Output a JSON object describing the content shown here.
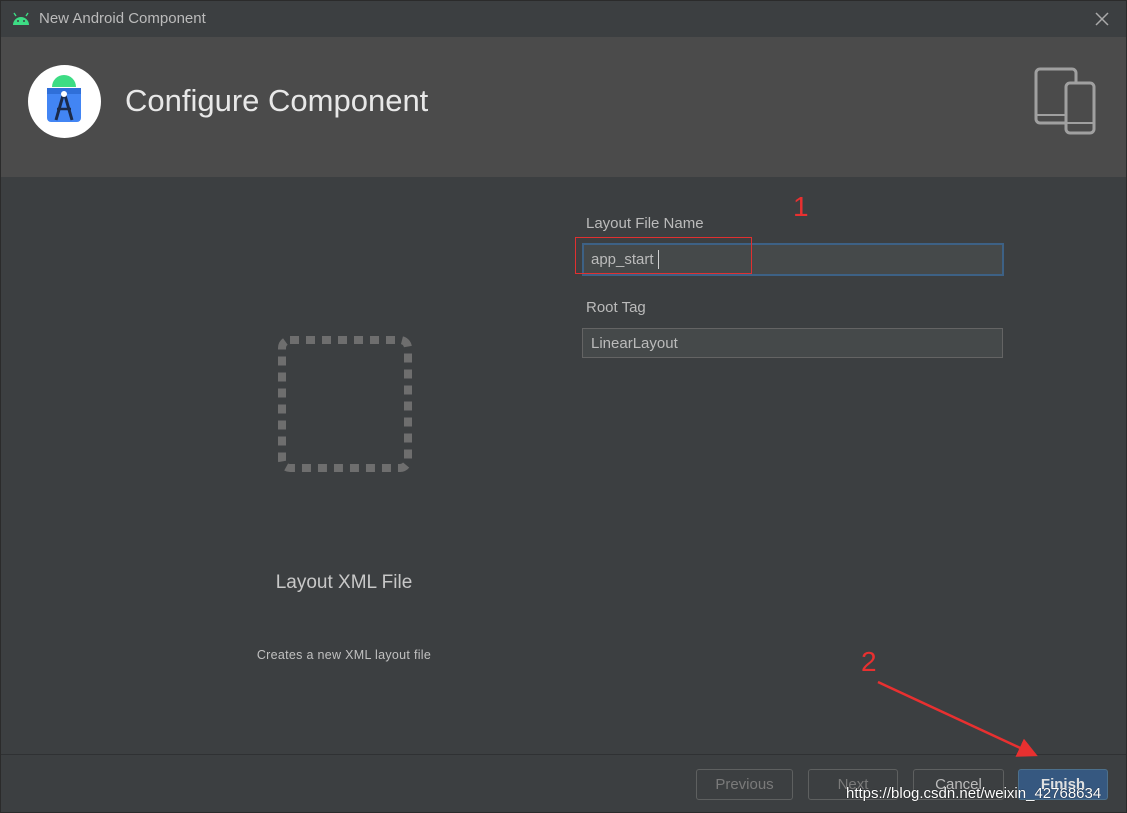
{
  "window": {
    "title": "New Android Component",
    "close_icon": "close-icon"
  },
  "header": {
    "title": "Configure Component",
    "logo_icon": "android-studio-logo",
    "devices_icon": "tablet-phone-icon"
  },
  "template": {
    "name": "Layout XML File",
    "description": "Creates a new XML layout file",
    "preview_icon": "empty-layout-placeholder-icon"
  },
  "form": {
    "layout_file_name_label": "Layout File Name",
    "layout_file_name_value": "app_start",
    "root_tag_label": "Root Tag",
    "root_tag_value": "LinearLayout"
  },
  "annotations": {
    "step1": "1",
    "step2": "2",
    "color": "#e83030"
  },
  "buttons": {
    "previous": "Previous",
    "next": "Next",
    "cancel": "Cancel",
    "finish": "Finish"
  },
  "watermark": "https://blog.csdn.net/weixin_42768634",
  "colors": {
    "background": "#3c3f41",
    "header": "#4b4b4b",
    "primary_button": "#365880",
    "focus_border": "#3d6185"
  }
}
